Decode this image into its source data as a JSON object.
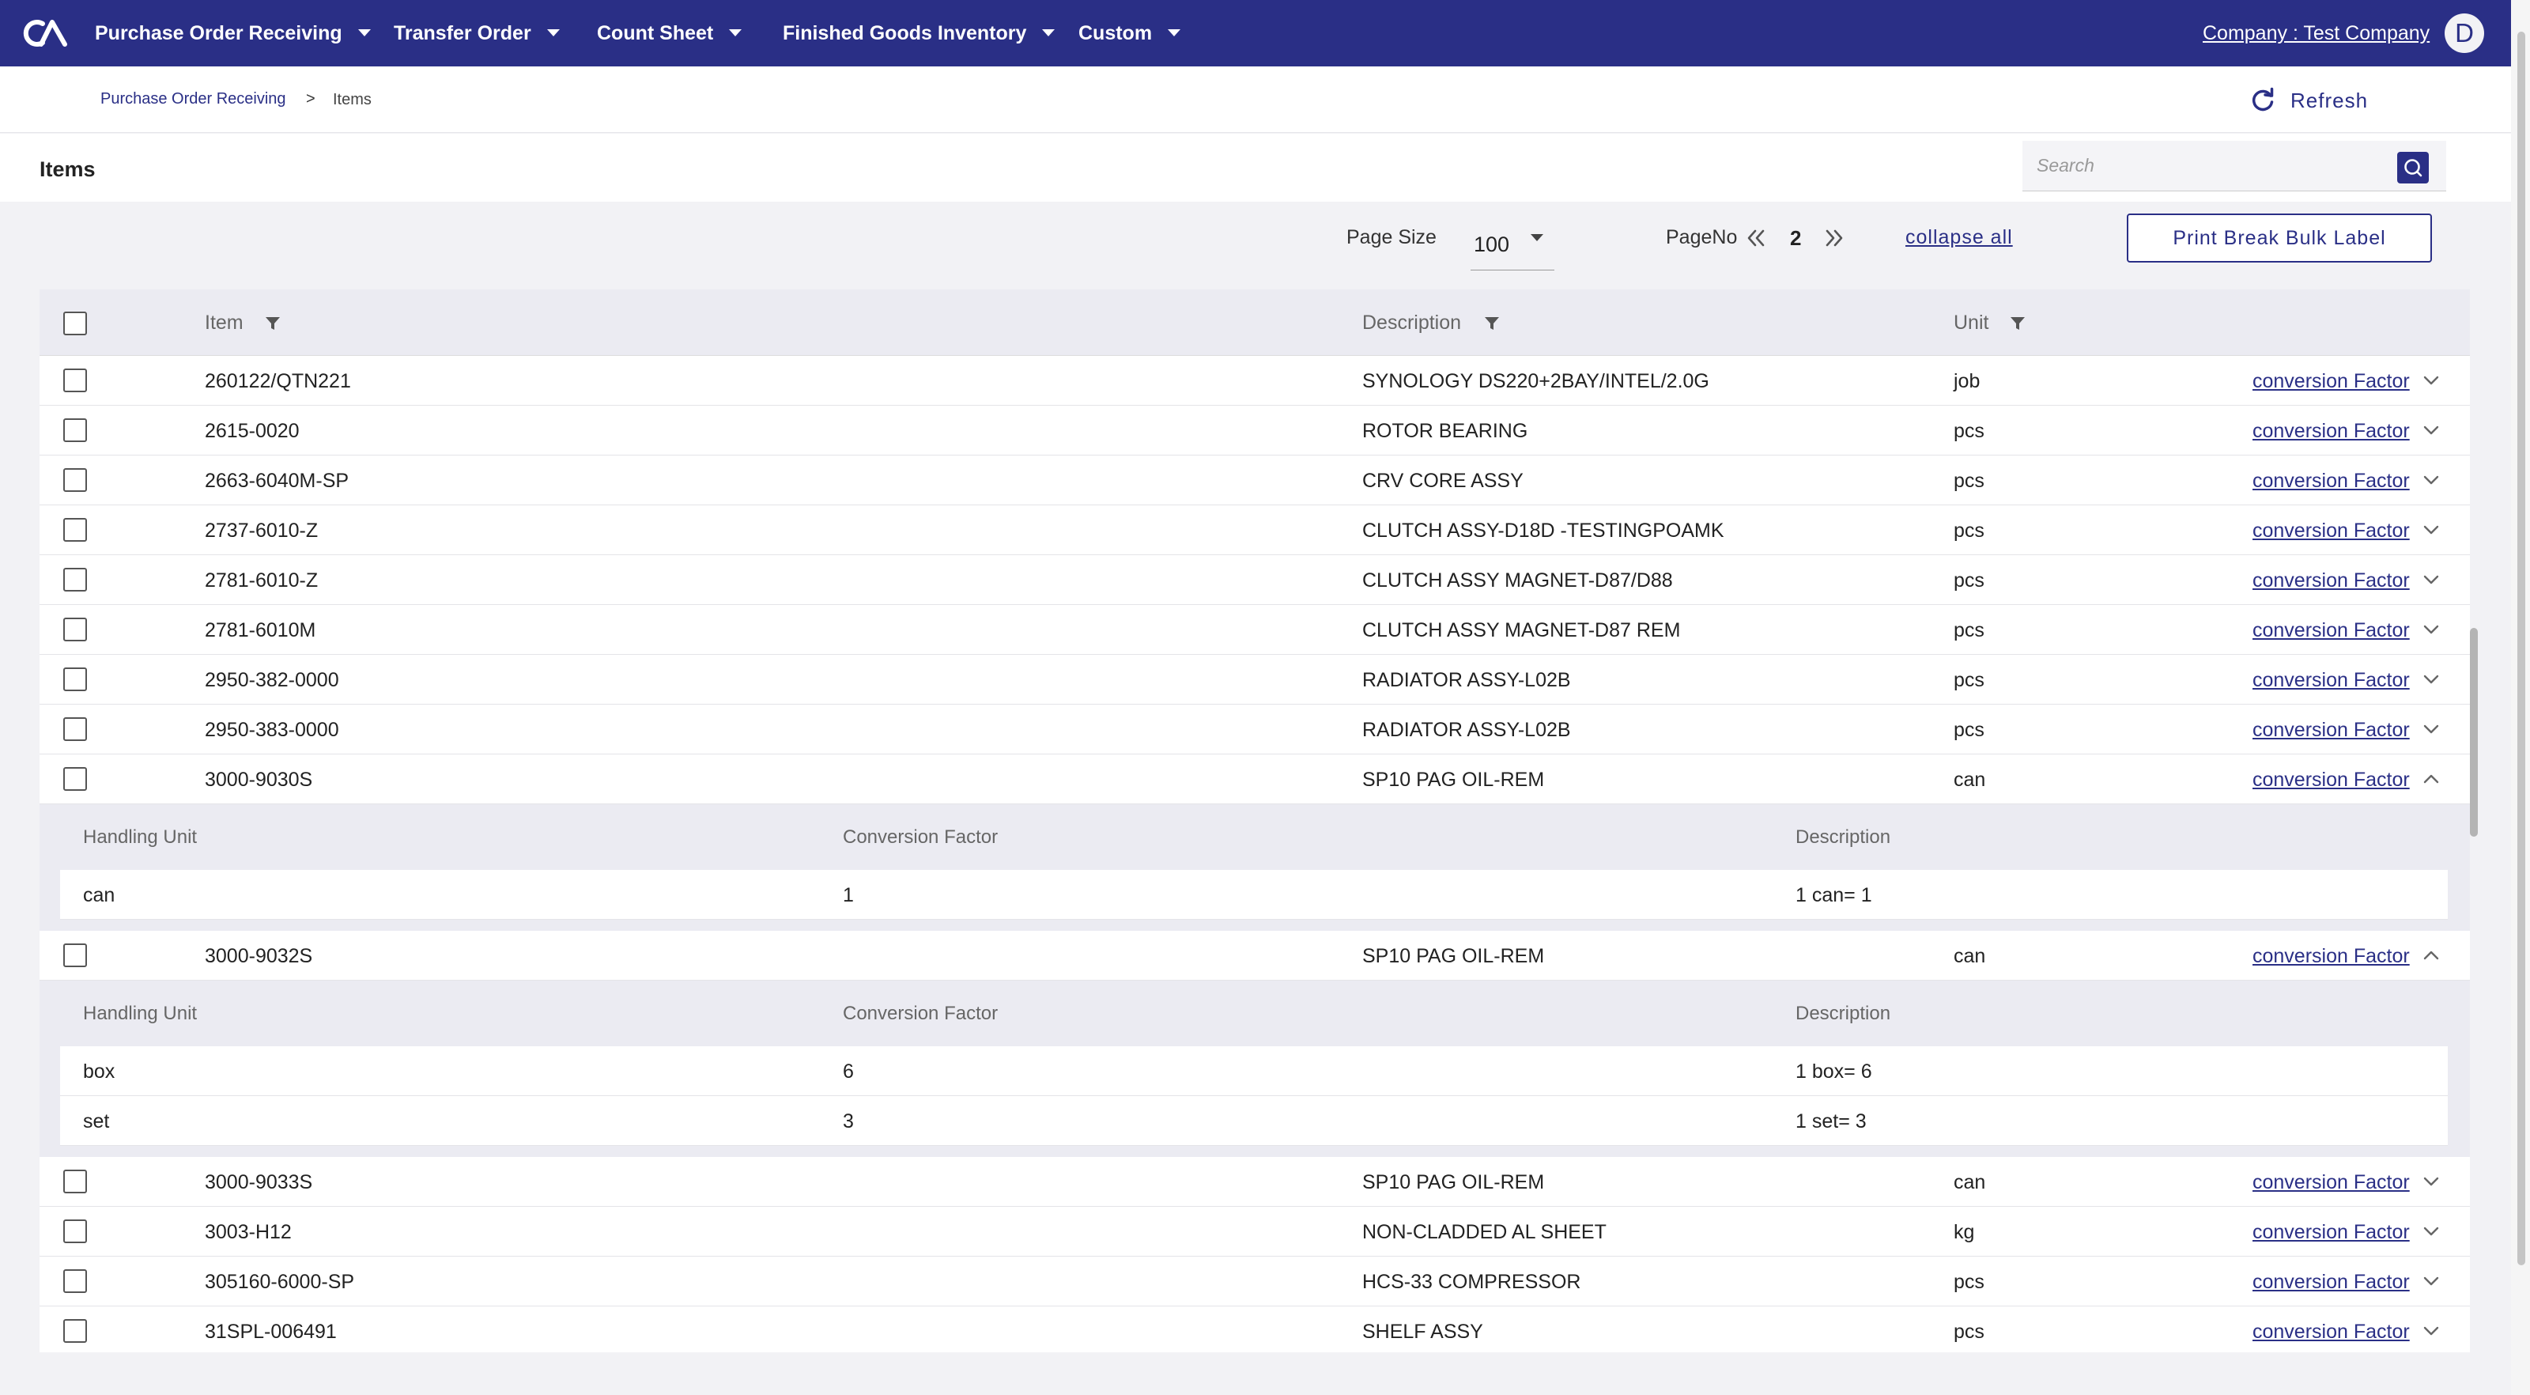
{
  "nav": {
    "items": [
      {
        "label": "Purchase Order Receiving"
      },
      {
        "label": "Transfer Order"
      },
      {
        "label": "Count Sheet"
      },
      {
        "label": "Finished Goods Inventory"
      },
      {
        "label": "Custom"
      }
    ],
    "company": "Company : Test Company",
    "avatar_letter": "D"
  },
  "breadcrumb": {
    "link": "Purchase Order Receiving",
    "separator": ">",
    "current": "Items"
  },
  "toolbar": {
    "refresh_label": "Refresh",
    "title": "Items",
    "search_placeholder": "Search"
  },
  "pager": {
    "page_size_label": "Page Size",
    "page_size": "100",
    "page_no_label": "PageNo",
    "page_no": "2",
    "collapse_all": "collapse all",
    "print_label": "Print Break Bulk Label"
  },
  "table": {
    "columns": [
      "Item",
      "Description",
      "Unit"
    ],
    "link_label": "conversion Factor",
    "sub_columns": [
      "Handling Unit",
      "Conversion Factor",
      "Description"
    ],
    "rows": [
      {
        "item": "260122/QTN221",
        "description": "SYNOLOGY DS220+2BAY/INTEL/2.0G",
        "unit": "job",
        "expanded": false
      },
      {
        "item": "2615-0020",
        "description": "ROTOR BEARING",
        "unit": "pcs",
        "expanded": false
      },
      {
        "item": "2663-6040M-SP",
        "description": "CRV CORE ASSY",
        "unit": "pcs",
        "expanded": false
      },
      {
        "item": "2737-6010-Z",
        "description": "CLUTCH ASSY-D18D -TESTINGPOAMK",
        "unit": "pcs",
        "expanded": false
      },
      {
        "item": "2781-6010-Z",
        "description": "CLUTCH ASSY MAGNET-D87/D88",
        "unit": "pcs",
        "expanded": false
      },
      {
        "item": "2781-6010M",
        "description": "CLUTCH ASSY MAGNET-D87 REM",
        "unit": "pcs",
        "expanded": false
      },
      {
        "item": "2950-382-0000",
        "description": "RADIATOR ASSY-L02B",
        "unit": "pcs",
        "expanded": false
      },
      {
        "item": "2950-383-0000",
        "description": "RADIATOR ASSY-L02B",
        "unit": "pcs",
        "expanded": false
      },
      {
        "item": "3000-9030S",
        "description": "SP10 PAG OIL-REM",
        "unit": "can",
        "expanded": true,
        "details": [
          {
            "handling_unit": "can",
            "conversion_factor": "1",
            "description": "1 can= 1"
          }
        ]
      },
      {
        "item": "3000-9032S",
        "description": "SP10 PAG OIL-REM",
        "unit": "can",
        "expanded": true,
        "details": [
          {
            "handling_unit": "box",
            "conversion_factor": "6",
            "description": "1 box= 6"
          },
          {
            "handling_unit": "set",
            "conversion_factor": "3",
            "description": "1 set= 3"
          }
        ]
      },
      {
        "item": "3000-9033S",
        "description": "SP10 PAG OIL-REM",
        "unit": "can",
        "expanded": false
      },
      {
        "item": "3003-H12",
        "description": "NON-CLADDED AL SHEET",
        "unit": "kg",
        "expanded": false
      },
      {
        "item": "305160-6000-SP",
        "description": "HCS-33 COMPRESSOR",
        "unit": "pcs",
        "expanded": false
      },
      {
        "item": "31SPL-006491",
        "description": "SHELF ASSY",
        "unit": "pcs",
        "expanded": false
      }
    ]
  },
  "colors": {
    "brand": "#2a2f86",
    "header_bg": "#ebebf2",
    "page_bg": "#f2f2f5"
  }
}
